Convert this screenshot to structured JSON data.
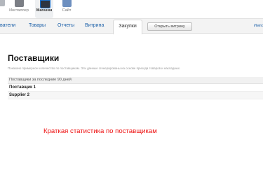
{
  "app_bar": {
    "apps": [
      {
        "id": "installer",
        "label": "Инсталлер",
        "icon": "installer-icon"
      },
      {
        "id": "store",
        "label": "Магазин",
        "icon": "store-icon",
        "active": true
      },
      {
        "id": "site",
        "label": "Сайт",
        "icon": "site-icon"
      }
    ]
  },
  "nav": {
    "tabs": [
      {
        "label": "ватели"
      },
      {
        "label": "Товары"
      },
      {
        "label": "Отчеты"
      },
      {
        "label": "Витрина"
      },
      {
        "label": "Закупки",
        "active": true
      }
    ],
    "open_storefront_label": "Открыть витрину",
    "right_link": "Импо"
  },
  "main": {
    "title": "Поставщики",
    "description": "Показано примерное количество по поставщикам. Эти данные сгенерированы на основе прихода товаров и накладных.",
    "table": {
      "header": "Поставщики за последние 90 дней",
      "rows": [
        "Поставщик 1",
        "Supplier 2"
      ]
    }
  },
  "annotation": {
    "text": "Краткая статистика по поставщикам",
    "color": "#ee1111"
  },
  "colors": {
    "link": "#1a5fa8",
    "nav_background": "#f3f3f3",
    "accent": "#1c6fc9"
  }
}
